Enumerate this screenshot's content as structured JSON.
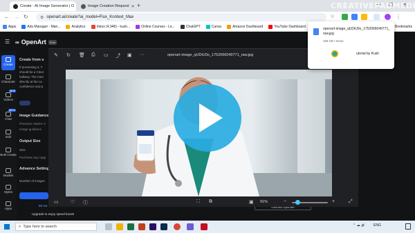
{
  "browser": {
    "tabs": [
      {
        "title": "Create - AI Image Generator | O",
        "active": true
      },
      {
        "title": "Image Creation Request",
        "active": false
      }
    ],
    "url": "openart.ai/create?ai_model=Flux_Kontext_Max",
    "bookmarks_label": "Apps",
    "bookmarks": [
      "Ads Manager - Man...",
      "Analytics",
      "Inbox (4,946) - kush...",
      "Online Courses - Le...",
      "ChatGPT",
      "Canva",
      "Amazon Dashboard",
      "YouTube Dashboard"
    ],
    "all_bookmarks": "All Bookmarks"
  },
  "watermark": "CREATIVEPADMEDIA",
  "download": {
    "file_name": "openart-image_qUDiU0o_1752066049771_raw.jpg",
    "status": "338 KB • Done",
    "behind_text": "utorial by Kush"
  },
  "app": {
    "brand": "OpenArt",
    "badge": "Free",
    "nav": [
      {
        "label": "Create"
      },
      {
        "label": "Character",
        "badge": "NEW"
      },
      {
        "label": "Videos",
        "badge": "NEW"
      },
      {
        "label": "Chat",
        "badge": "BETA"
      },
      {
        "label": "Edit"
      },
      {
        "label": "Bulk Create"
      },
      {
        "label": "Models"
      },
      {
        "label": "Styles"
      },
      {
        "label": "Apps"
      }
    ],
    "section_create": "Create from s",
    "prompt_text": [
      "If presenting it, T",
      "should be a Clear",
      "hallway. The man",
      "directly at the ca",
      "confidence and p"
    ],
    "image_guidance": "Image Guidance",
    "image_guidance_desc": [
      "Precision Starter vi",
      "Image guidance"
    ],
    "output_size": "Output Size",
    "size_label": "Size",
    "purchase_hint": "Purchase any Upgr",
    "advance_settings": "Advance Settings",
    "num_images": "Number of images",
    "credits": "50 cre",
    "upgrade": "Upgrade to enjoy speed boost!",
    "dismiss_upscale": "Dismiss Upscale"
  },
  "viewer": {
    "title": "openart-image_qUDiU0o_1752066049771_raw.jpg",
    "zoom": "91%"
  },
  "taskbar": {
    "search_placeholder": "Type here to search",
    "lang": "ENG"
  },
  "colors": {
    "accent": "#2563eb",
    "play": "#29abe2"
  }
}
